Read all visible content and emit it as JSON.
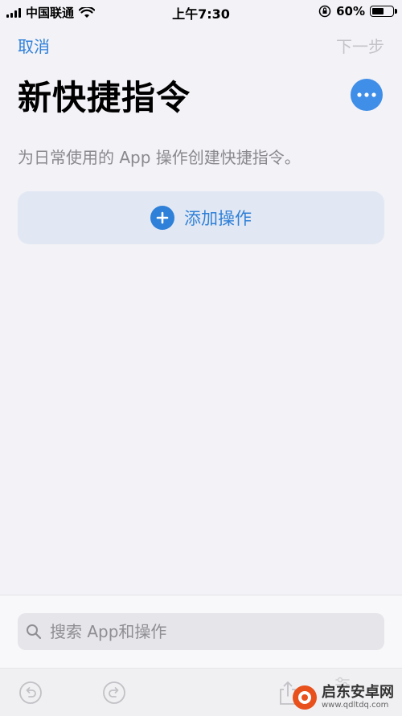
{
  "status_bar": {
    "carrier": "中国联通",
    "time": "上午7:30",
    "battery_percent": "60%",
    "battery_level": 0.6
  },
  "nav": {
    "cancel_label": "取消",
    "next_label": "下一步"
  },
  "page": {
    "title": "新快捷指令",
    "subtitle": "为日常使用的 App 操作创建快捷指令。",
    "add_action_label": "添加操作"
  },
  "search": {
    "placeholder": "搜索 App和操作",
    "value": ""
  },
  "toolbar": {
    "icons": [
      "undo-icon",
      "redo-icon",
      "share-icon",
      "settings-icon"
    ]
  },
  "watermark": {
    "name": "启东安卓网",
    "url": "www.qdltdq.com"
  },
  "colors": {
    "accent": "#2f80d8",
    "background": "#f2f2f7",
    "disabled": "#c4c4c8"
  }
}
